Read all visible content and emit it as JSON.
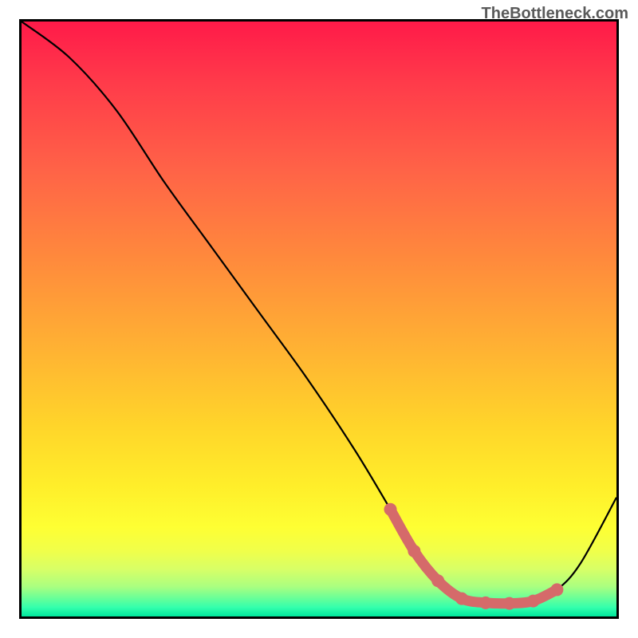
{
  "watermark": "TheBottleneck.com",
  "chart_data": {
    "type": "line",
    "title": "",
    "xlabel": "",
    "ylabel": "",
    "xlim": [
      0,
      100
    ],
    "ylim": [
      0,
      100
    ],
    "series": [
      {
        "name": "curve",
        "x": [
          0,
          8,
          16,
          24,
          32,
          40,
          48,
          56,
          62,
          66,
          70,
          74,
          78,
          82,
          86,
          90,
          94,
          100
        ],
        "values": [
          100,
          94,
          85,
          73,
          62,
          51,
          40,
          28,
          18,
          11,
          6,
          3,
          2.3,
          2.2,
          2.6,
          4.5,
          9,
          20
        ]
      }
    ],
    "highlight": {
      "name": "optimal-range",
      "x": [
        62,
        66,
        70,
        74,
        78,
        82,
        86,
        90
      ],
      "values": [
        18,
        11,
        6,
        3,
        2.3,
        2.2,
        2.6,
        4.5
      ]
    },
    "axes_visible": false,
    "background": "rainbow-gradient"
  }
}
